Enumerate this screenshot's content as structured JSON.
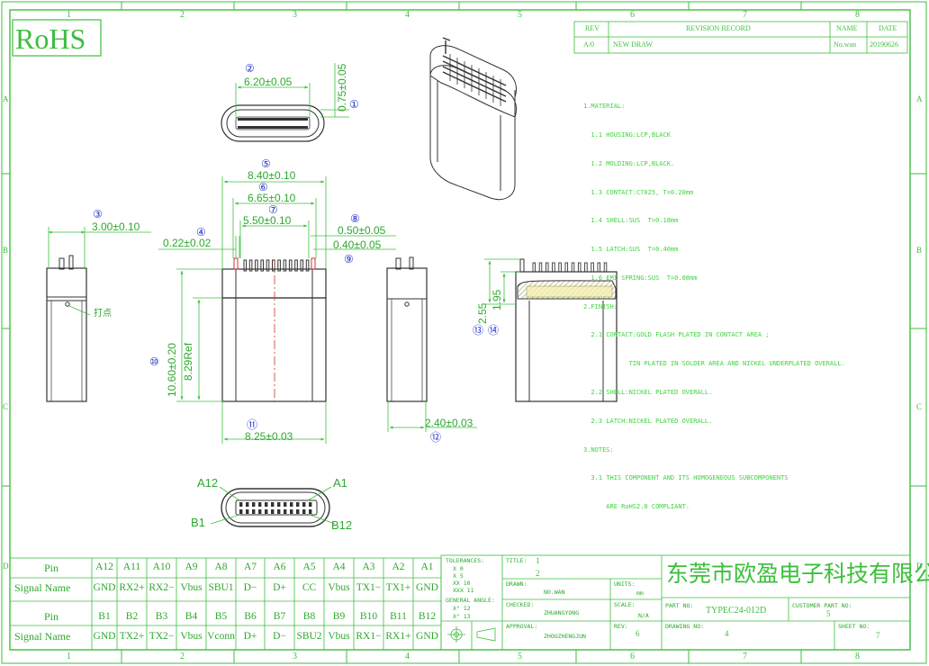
{
  "rohs": "RoHS",
  "grid": {
    "top_numbers": [
      "1",
      "2",
      "3",
      "4",
      "5",
      "6",
      "7",
      "8"
    ],
    "bottom_numbers": [
      "1",
      "2",
      "3",
      "4",
      "5",
      "6",
      "7",
      "8"
    ],
    "side_letters": [
      "A",
      "B",
      "C",
      "D"
    ]
  },
  "revision": {
    "rev_header": "REV",
    "record_header": "REVISION RECORD",
    "name_header": "NAME",
    "date_header": "DATE",
    "rev": "A/0",
    "record": "NEW DRAW",
    "name": "No.wan",
    "date": "20190626"
  },
  "notes": [
    "1.MATERIAL:",
    "  1.1 HOUSING:LCP,BLACK",
    "  1.2 MOLDING:LCP,BLACK.",
    "  1.3 CONTACT:C7025, T=0.20mm",
    "  1.4 SHELL:SUS  T=0.18mm",
    "  1.5 LATCH:SUS  T=0.40mm",
    "  1.6 EMI SPRING:SUS  T=0.08mm",
    "2.FINISH:",
    "  2.1 CONTACT:GOLD FLASH PLATED IN CONTACT AREA ;",
    "            TIN PLATED IN SOLDER AREA AND NICKEL UNDERPLATED OVERALL.",
    "  2.2 SHELL:NICKEL PLATED OVERALL.",
    "  2.3 LATCH:NICKEL PLATED OVERALL.",
    "3.NOTES:",
    "  3.1 THIS COMPONENT AND ITS HOMOGENEOUS SUBCOMPONENTS",
    "      ARE RoHS2.0 COMPLIANT."
  ],
  "dimensions": {
    "d_6_20": "6.20±0.05",
    "d_0_75": "0.75±0.05",
    "d_8_40": "8.40±0.10",
    "d_6_65": "6.65±0.10",
    "d_5_50": "5.50±0.10",
    "d_0_50": "0.50±0.05",
    "d_0_40": "0.40±0.05",
    "d_0_22": "0.22±0.02",
    "d_3_00": "3.00±0.10",
    "d_10_60": "10.60±0.20",
    "d_8_29": "8.29Ref",
    "d_8_25": "8.25±0.03",
    "d_2_40": "2.40±0.03",
    "d_2_55": "2.55",
    "d_1_95": "1.95",
    "dot_label": "打点"
  },
  "callouts": [
    "①",
    "②",
    "③",
    "④",
    "⑤",
    "⑥",
    "⑦",
    "⑧",
    "⑨",
    "⑩",
    "⑪",
    "⑫",
    "⑬",
    "⑭"
  ],
  "front_labels": {
    "a12": "A12",
    "a1": "A1",
    "b1": "B1",
    "b12": "B12"
  },
  "pin_table": {
    "pin_label": "Pin",
    "signal_label": "Signal Name",
    "row_a_pins": [
      "A12",
      "A11",
      "A10",
      "A9",
      "A8",
      "A7",
      "A6",
      "A5",
      "A4",
      "A3",
      "A2",
      "A1"
    ],
    "row_a_signals": [
      "GND",
      "RX2+",
      "RX2−",
      "Vbus",
      "SBU1",
      "D−",
      "D+",
      "CC",
      "Vbus",
      "TX1−",
      "TX1+",
      "GND"
    ],
    "row_b_pins": [
      "B1",
      "B2",
      "B3",
      "B4",
      "B5",
      "B6",
      "B7",
      "B8",
      "B9",
      "B10",
      "B11",
      "B12"
    ],
    "row_b_signals": [
      "GND",
      "TX2+",
      "TX2−",
      "Vbus",
      "Vconn",
      "D+",
      "D−",
      "SBU2",
      "Vbus",
      "RX1−",
      "RX1+",
      "GND"
    ]
  },
  "tolerances": {
    "title": "TOLERANCES:",
    "rows": [
      "X      0",
      "X      5",
      "XX    10",
      "XXX   11"
    ],
    "angle_title": "GENERAL ANGLE:",
    "angle_rows": [
      "X°    12",
      "X°    13"
    ]
  },
  "title_block": {
    "title_label": "TITLE:",
    "title_value_1": "1",
    "title_value_2": "2",
    "units_label": "UNITS:",
    "units_value": "mm",
    "drawn_label": "DRAWN:",
    "drawn_value": "NO.WAN",
    "checked_label": "CHECKED:",
    "checked_value": "ZHUANGYONG",
    "scale_label": "SCALE:",
    "scale_value": "N/A",
    "approval_label": "APPROVAL:",
    "approval_value": "ZHOUZHENGJUN",
    "rev_label": "REV:",
    "rev_value": "6",
    "company": "东莞市欧盈电子科技有限公司",
    "part_no_label": "PART NO:",
    "part_no": "TYPEC24-012D",
    "customer_part_label": "CUSTOMER PART NO:",
    "customer_part": "5",
    "drawing_no_label": "DRAWING NO:",
    "drawing_no": "4",
    "sheet_no_label": "SHEET NO:",
    "sheet_no": "7"
  },
  "colors": {
    "line": "#3cbf3c",
    "dim_text": "#2ea82e",
    "callout": "#2233cc",
    "dark": "#333333",
    "note_text": "#3fd43f"
  }
}
